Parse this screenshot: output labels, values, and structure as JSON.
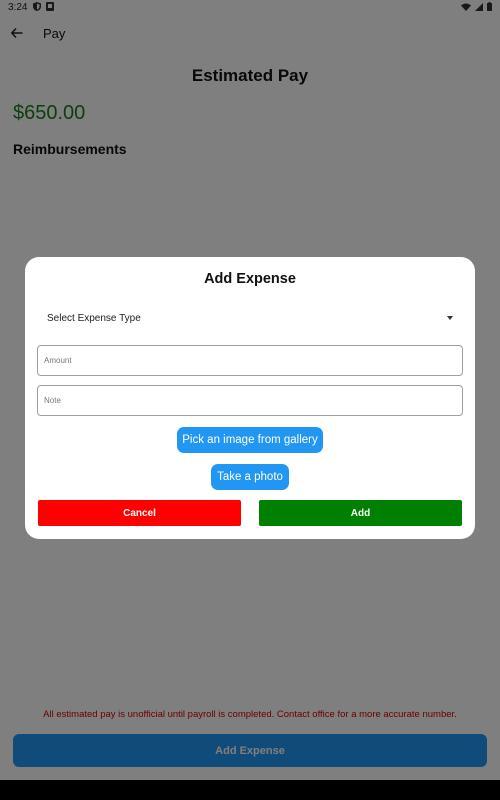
{
  "status_bar": {
    "time": "3:24",
    "icons": [
      "shield-icon",
      "notification-icon",
      "wifi-icon",
      "signal-icon",
      "battery-icon"
    ]
  },
  "app_bar": {
    "title": "Pay",
    "back_icon": "arrow-left-icon"
  },
  "main": {
    "heading": "Estimated Pay",
    "amount": "$650.00",
    "reimbursements_heading": "Reimbursements",
    "disclaimer": "All estimated pay is unofficial until payroll is completed. Contact office for a more accurate number.",
    "add_expense_label": "Add Expense"
  },
  "dialog": {
    "title": "Add Expense",
    "expense_type_select": "Select Expense Type",
    "amount_placeholder": "Amount",
    "note_placeholder": "Note",
    "gallery_button": "Pick an image from gallery",
    "photo_button": "Take a photo",
    "cancel_button": "Cancel",
    "add_button": "Add"
  },
  "colors": {
    "accent": "#2196f3",
    "amount": "#1b7f1b",
    "cancel": "#ff0000",
    "add": "#008000",
    "disclaimer": "#d40000"
  }
}
